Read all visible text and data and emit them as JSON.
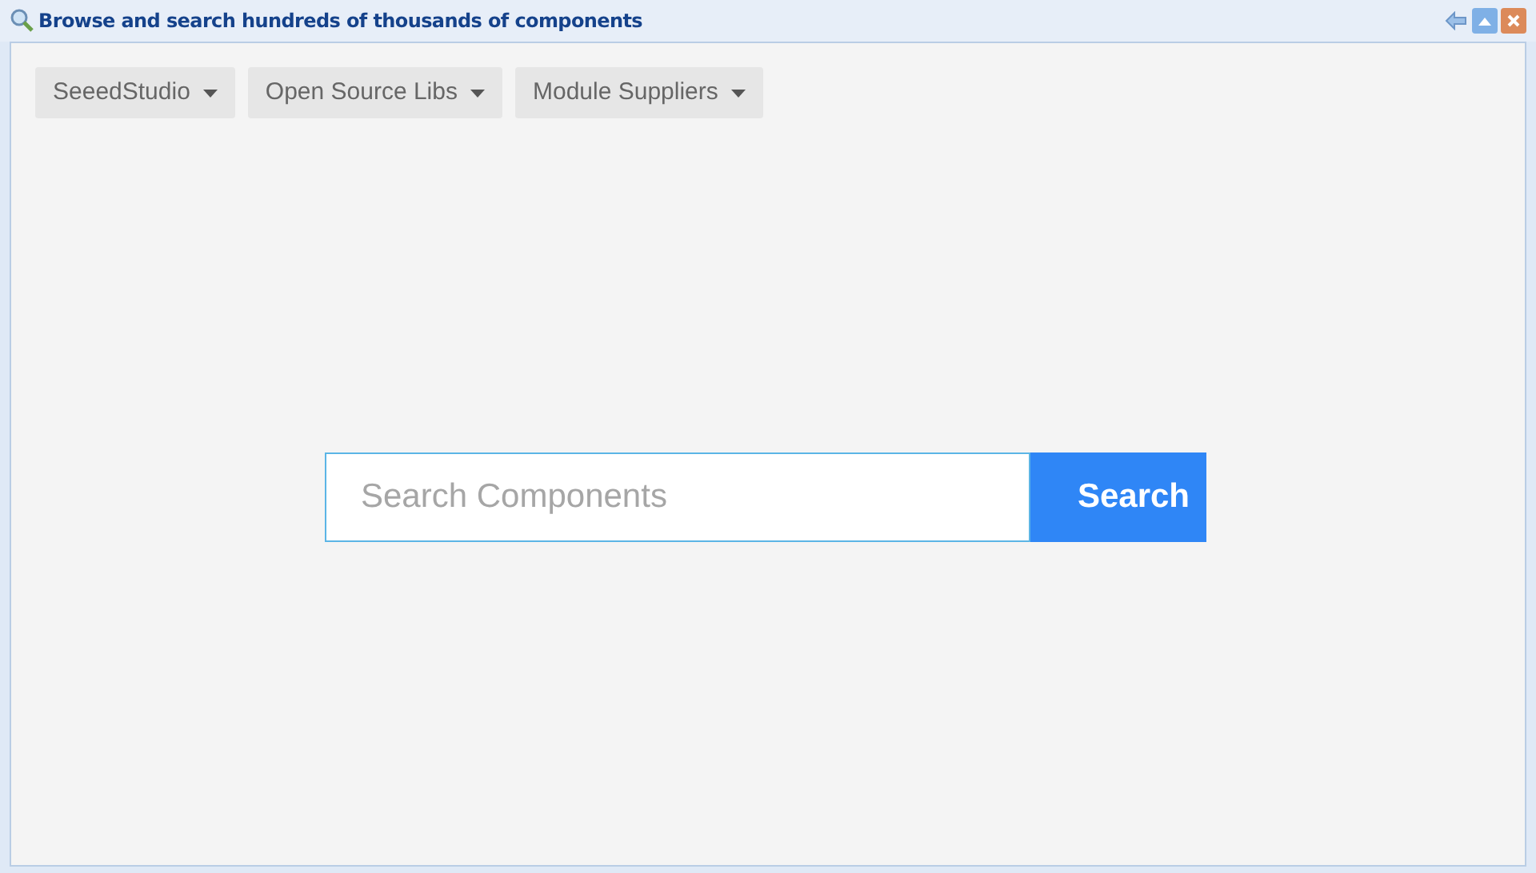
{
  "window": {
    "title": "Browse and search hundreds of thousands of components"
  },
  "dropdowns": [
    {
      "label": "SeeedStudio"
    },
    {
      "label": "Open Source Libs"
    },
    {
      "label": "Module Suppliers"
    }
  ],
  "search": {
    "placeholder": "Search Components",
    "button": "Search"
  }
}
